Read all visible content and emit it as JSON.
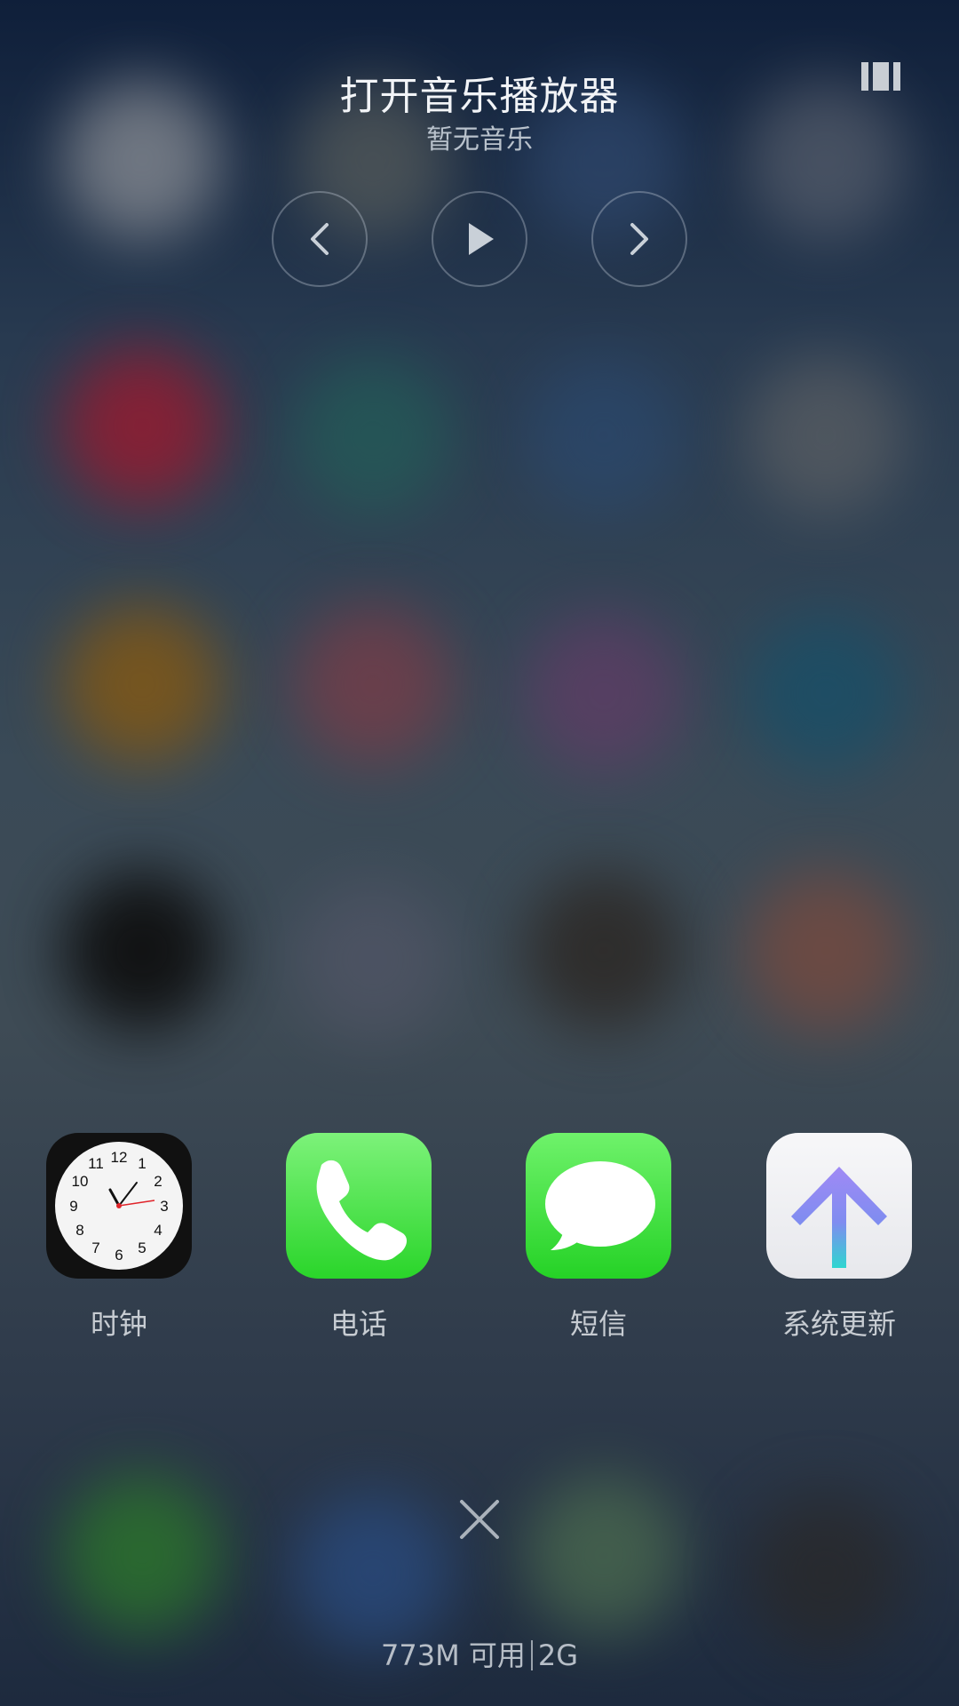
{
  "music": {
    "title": "打开音乐播放器",
    "subtitle": "暂无音乐"
  },
  "controls": {
    "prev_icon": "chevron-left-icon",
    "play_icon": "play-icon",
    "next_icon": "chevron-right-icon"
  },
  "apps": [
    {
      "label": "时钟",
      "icon": "clock-icon"
    },
    {
      "label": "电话",
      "icon": "phone-icon"
    },
    {
      "label": "短信",
      "icon": "message-bubble-icon"
    },
    {
      "label": "系统更新",
      "icon": "up-arrow-icon"
    }
  ],
  "clock_numbers": [
    "12",
    "1",
    "2",
    "3",
    "4",
    "5",
    "6",
    "7",
    "8",
    "9",
    "10",
    "11"
  ],
  "memory": {
    "available": "773M 可用",
    "total": "2G"
  },
  "colors": {
    "green_top": "#7df27a",
    "green_bottom": "#2ad52a",
    "arrow_purple": "#9a86f3",
    "arrow_teal": "#2dd4d4"
  }
}
